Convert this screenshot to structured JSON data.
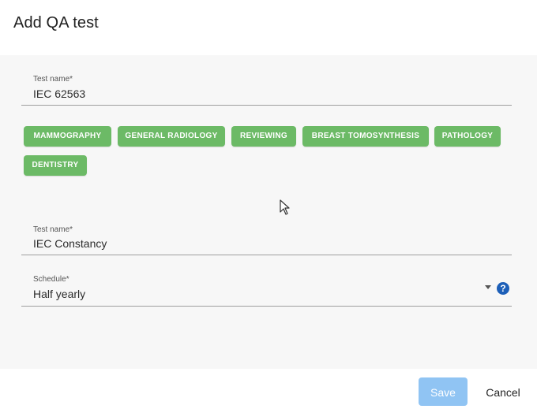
{
  "dialog": {
    "title": "Add QA test"
  },
  "fields": {
    "test_name_1": {
      "label": "Test name*",
      "value": "IEC 62563"
    },
    "test_name_2": {
      "label": "Test name*",
      "value": "IEC Constancy"
    },
    "schedule": {
      "label": "Schedule*",
      "value": "Half yearly",
      "help_icon": "help-icon"
    }
  },
  "chips": [
    "MAMMOGRAPHY",
    "GENERAL RADIOLOGY",
    "REVIEWING",
    "BREAST TOMOSYNTHESIS",
    "PATHOLOGY",
    "DENTISTRY"
  ],
  "actions": {
    "save": "Save",
    "cancel": "Cancel"
  },
  "colors": {
    "chip": "#6cba66",
    "save_button": "#90c4f3",
    "help_icon": "#1d5fb8",
    "body_background": "#f7f7f7"
  }
}
